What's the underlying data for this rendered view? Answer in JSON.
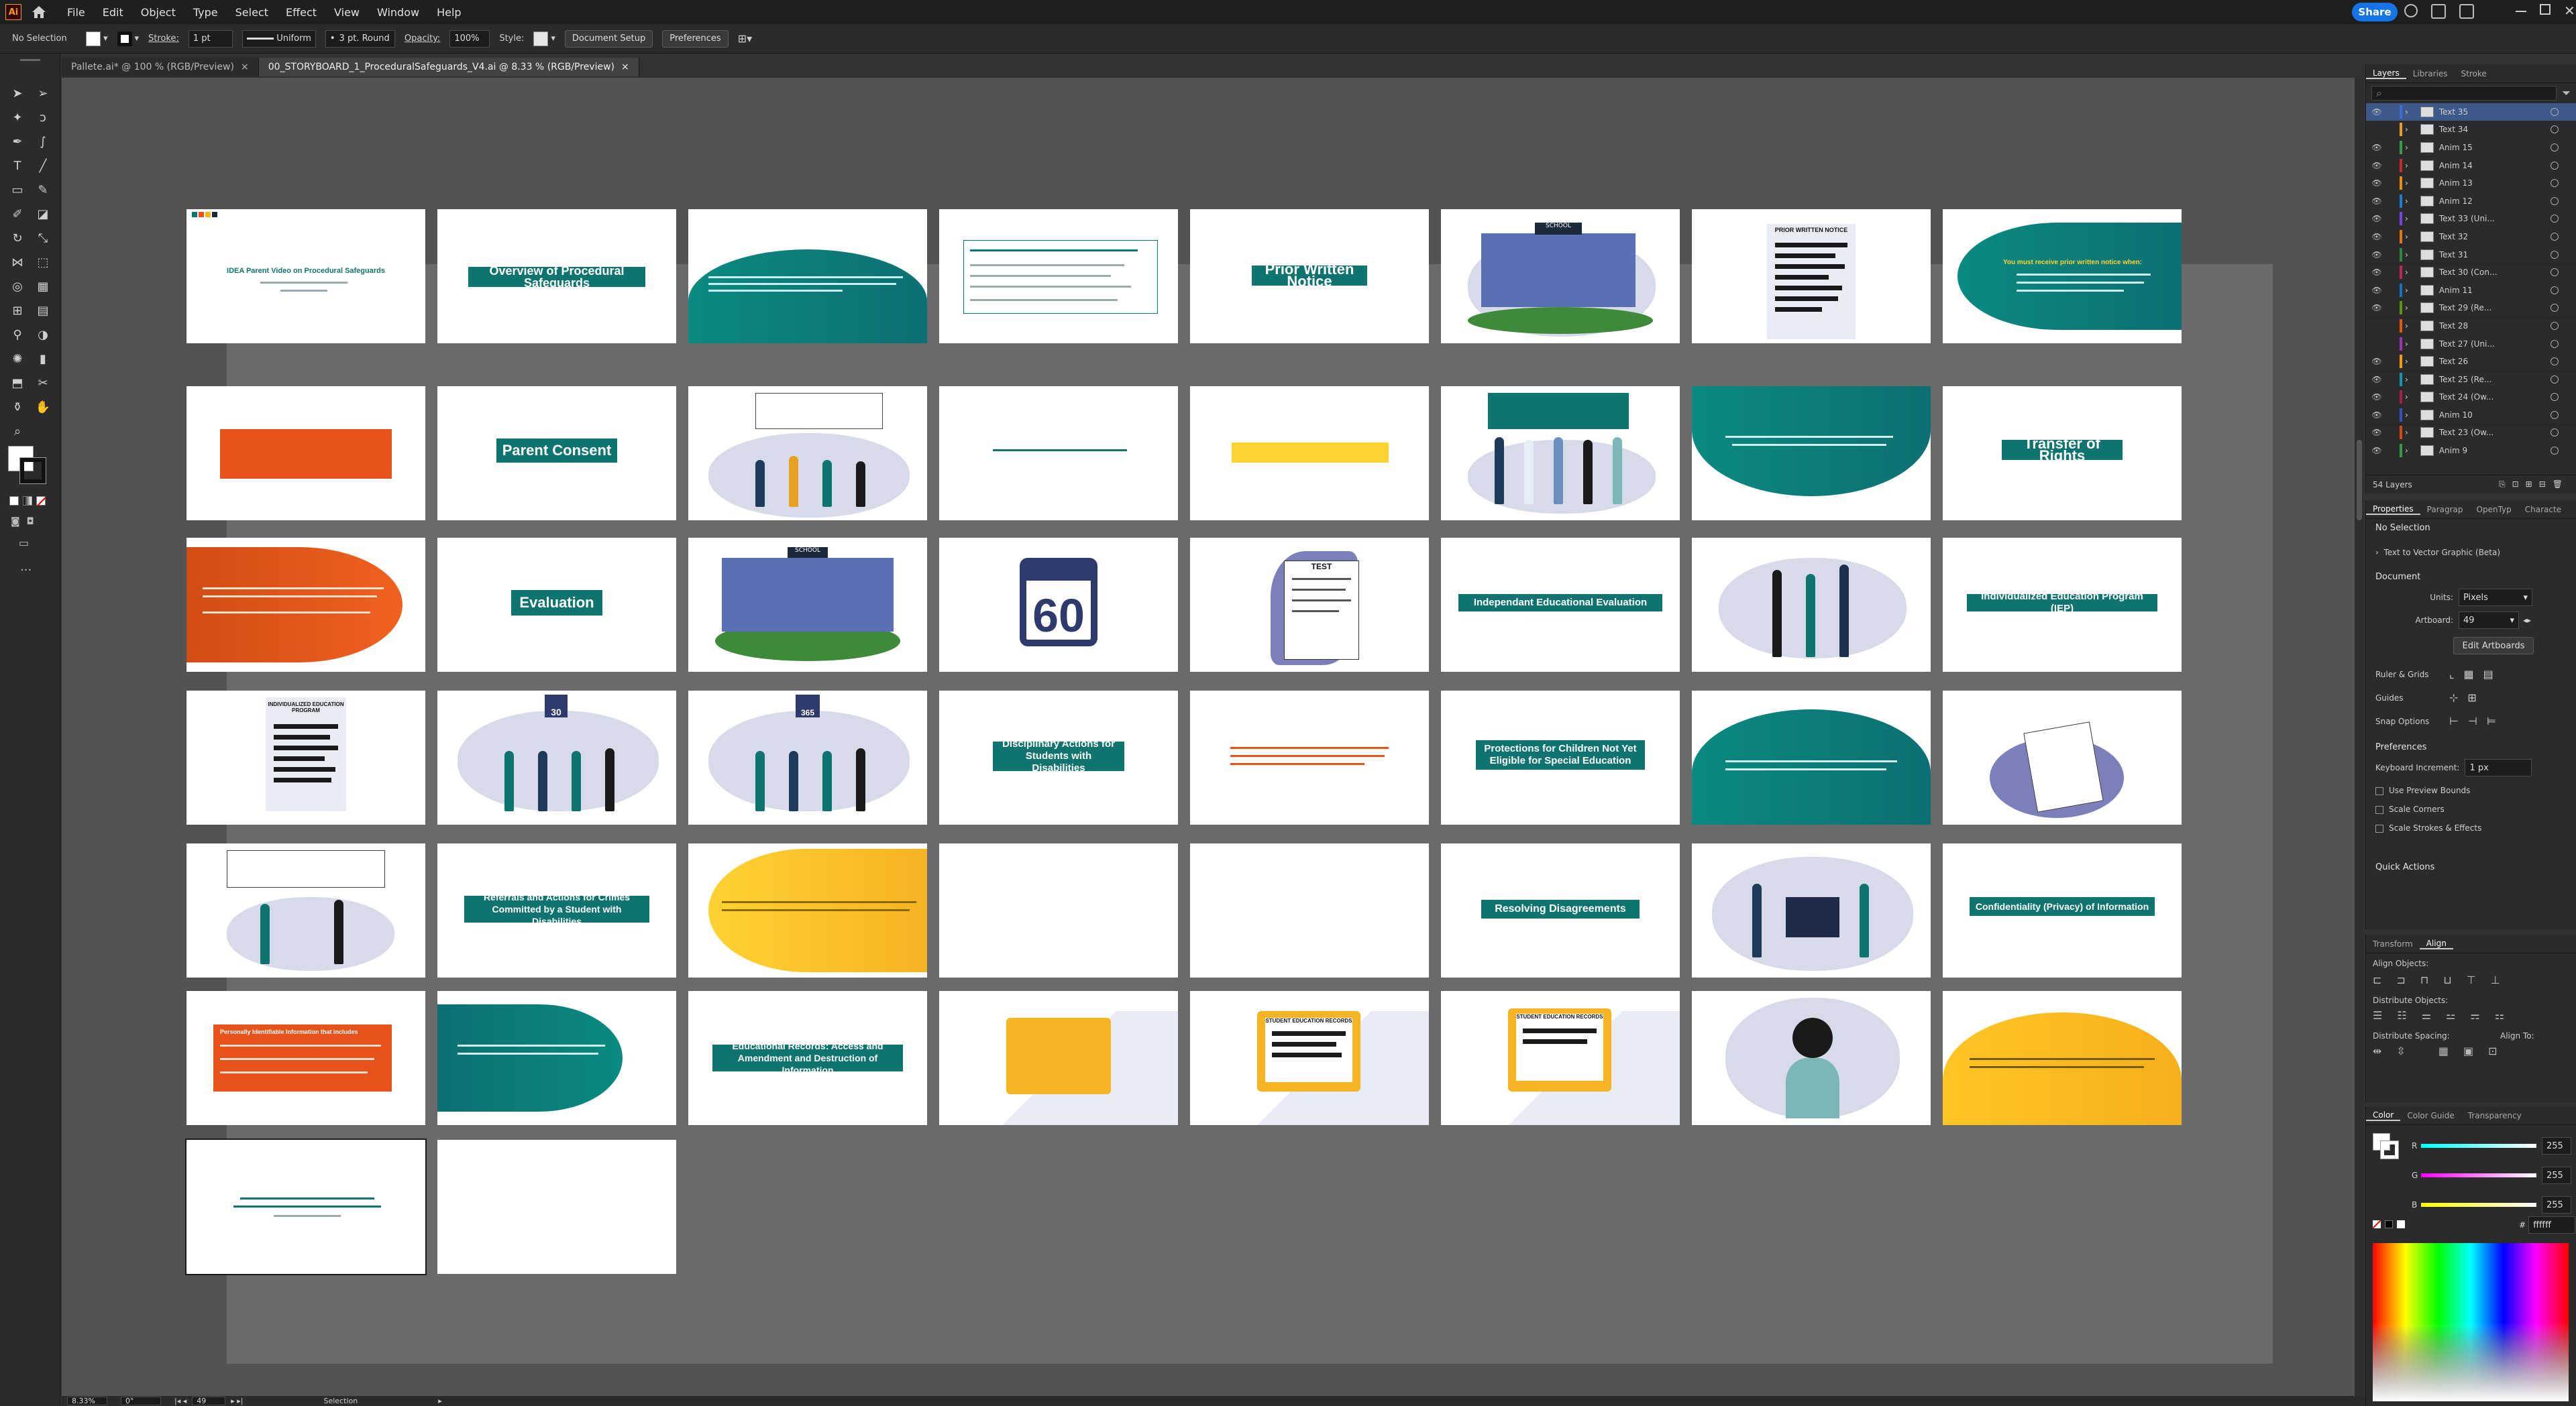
{
  "app": {
    "logo": "Ai",
    "home_icon": "home-icon"
  },
  "menu": [
    "File",
    "Edit",
    "Object",
    "Type",
    "Select",
    "Effect",
    "View",
    "Window",
    "Help"
  ],
  "share_label": "Share",
  "control_bar": {
    "selection": "No Selection",
    "stroke_label": "Stroke:",
    "stroke_weight": "1 pt",
    "stroke_profile": "Uniform",
    "brush": "3 pt. Round",
    "opacity_label": "Opacity:",
    "opacity": "100%",
    "style_label": "Style:",
    "document_setup": "Document Setup",
    "preferences": "Preferences"
  },
  "doc_tabs": [
    {
      "label": "Pallete.ai* @ 100 % (RGB/Preview)",
      "close": "×"
    },
    {
      "label": "00_STORYBOARD_1_ProceduralSafeguards_V4.ai @ 8.33 % (RGB/Preview)",
      "close": "×"
    }
  ],
  "slides": {
    "s1": "IDEA Parent Video on Procedural Safeguards",
    "s2": "Overview of Procedural Safeguards",
    "s5": "Prior Written Notice",
    "s5b": "PRIOR WRITTEN NOTICE",
    "s6": "SCHOOL",
    "s8": "You must receive prior written notice when:",
    "s10": "Parent Consent",
    "s16": "Transfer of Rights",
    "s18": "Evaluation",
    "s19": "SCHOOL",
    "s20": "60",
    "s21": "TEST",
    "s22": "Independant Educational Evaluation",
    "s24": "Individualized Education Program (IEP)",
    "s25": "INDIVIDUALIZED EDUCATION PROGRAM",
    "s26": "30",
    "s27": "365",
    "s28": "Disciplinary Actions for Students with Disabilities",
    "s30": "Protections for Children Not Yet Eligible for Special Education",
    "s34": "Referrals and Actions for Crimes Committed by a Student with Disabilities",
    "s38": "Resolving Disagreements",
    "s40": "Confidentiality (Privacy) of Information",
    "s41": "Personally Identifiable Information that includes",
    "s43": "Educational Records: Access and Amendment and Destruction of Information",
    "s45": "STUDENT EDUCATION RECORDS",
    "s46": "STUDENT EDUCATION RECORDS"
  },
  "layers_panel": {
    "tabs": [
      "Layers",
      "Libraries",
      "Stroke"
    ],
    "rows": [
      {
        "name": "Text 35",
        "color": "#3f6bd9"
      },
      {
        "name": "Text 34",
        "color": "#e6a11f"
      },
      {
        "name": "Anim 15",
        "color": "#2f9e44"
      },
      {
        "name": "Anim 14",
        "color": "#c92a2a"
      },
      {
        "name": "Anim 13",
        "color": "#f08c00"
      },
      {
        "name": "Anim 12",
        "color": "#1c7ed6"
      },
      {
        "name": "Text 33 (Uni...",
        "color": "#7048e8"
      },
      {
        "name": "Text 32",
        "color": "#e67700"
      },
      {
        "name": "Text 31",
        "color": "#2b8a3e"
      },
      {
        "name": "Text 30 (Con...",
        "color": "#c2255c"
      },
      {
        "name": "Anim 11",
        "color": "#1971c2"
      },
      {
        "name": "Text 29 (Re...",
        "color": "#5c940d"
      },
      {
        "name": "Text 28",
        "color": "#e8590c"
      },
      {
        "name": "Text 27 (Uni...",
        "color": "#9c36b5"
      },
      {
        "name": "Text 26",
        "color": "#f59f00"
      },
      {
        "name": "Text 25 (Re...",
        "color": "#1098ad"
      },
      {
        "name": "Text 24 (Ow...",
        "color": "#a61e4d"
      },
      {
        "name": "Anim 10",
        "color": "#364fc7"
      },
      {
        "name": "Text 23 (Ow...",
        "color": "#d9480f"
      },
      {
        "name": "Anim 9",
        "color": "#2f9e44"
      }
    ],
    "count": "54 Layers"
  },
  "properties": {
    "tabs": [
      "Properties",
      "Paragrap",
      "OpenTyp",
      "Characte"
    ],
    "selection": "No Selection",
    "text_to_vector": "Text to Vector Graphic (Beta)",
    "document": "Document",
    "units_label": "Units:",
    "units": "Pixels",
    "artboard_label": "Artboard:",
    "artboard": "49",
    "edit_artboards": "Edit Artboards",
    "ruler_grids": "Ruler & Grids",
    "guides": "Guides",
    "snap_options": "Snap Options",
    "preferences": "Preferences",
    "keyboard_increment_label": "Keyboard Increment:",
    "keyboard_increment": "1 px",
    "use_preview_bounds": "Use Preview Bounds",
    "scale_corners": "Scale Corners",
    "scale_strokes": "Scale Strokes & Effects",
    "quick_actions": "Quick Actions"
  },
  "align_panel": {
    "tabs": [
      "Transform",
      "Align"
    ],
    "align_objects": "Align Objects:",
    "distribute_objects": "Distribute Objects:",
    "distribute_spacing": "Distribute Spacing:",
    "align_to": "Align To:"
  },
  "color_panel": {
    "tabs": [
      "Color",
      "Color Guide",
      "Transparency"
    ],
    "channels": [
      {
        "label": "R",
        "value": "255"
      },
      {
        "label": "G",
        "value": "255"
      },
      {
        "label": "B",
        "value": "255"
      }
    ],
    "hex": "ffffff"
  },
  "status": {
    "zoom": "8.33%",
    "rotation": "0°",
    "artboard": "49",
    "mode": "Selection"
  }
}
